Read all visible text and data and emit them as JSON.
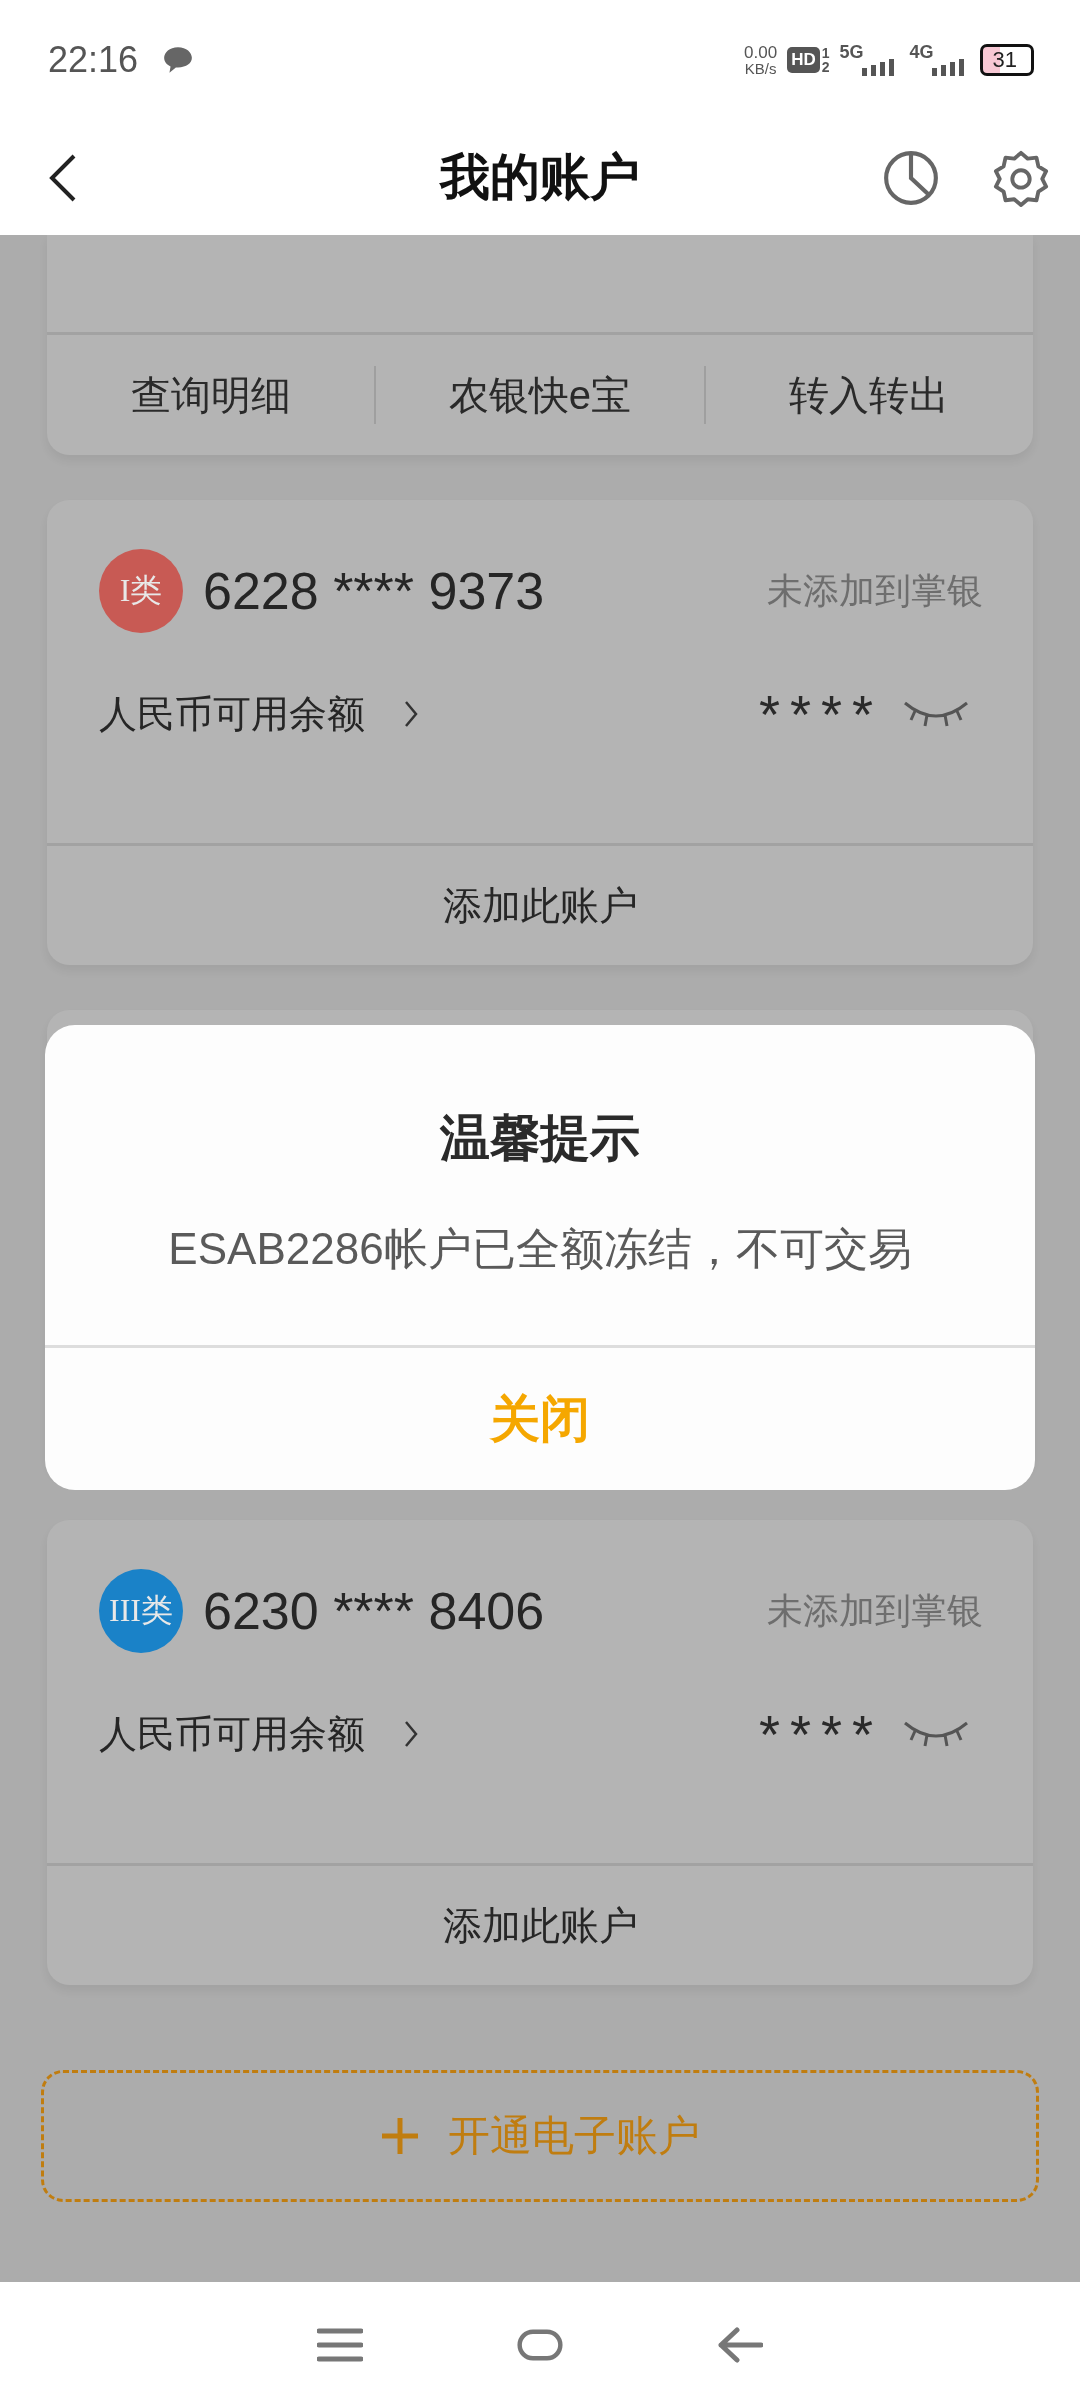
{
  "status_bar": {
    "time": "22:16",
    "net_speed": "0.00",
    "net_unit": "KB/s",
    "hd": "HD",
    "sim_1": "1",
    "sim_2": "2",
    "net_5g": "5G",
    "net_4g": "4G",
    "battery": "31"
  },
  "header": {
    "title": "我的账户"
  },
  "top_card": {
    "actions": [
      "查询明细",
      "农银快e宝",
      "转入转出"
    ]
  },
  "accounts": [
    {
      "kind": "account",
      "badge": "I类",
      "color": "#c85a54",
      "number": "6228 **** 9373",
      "status": "未添加到掌银",
      "balance_label": "人民币可用余额",
      "balance": "****",
      "add_label": "添加此账户"
    },
    {
      "kind": "covered"
    },
    {
      "kind": "account",
      "badge": "III类",
      "color": "#1a82c8",
      "number": "6230 **** 8406",
      "status": "未添加到掌银",
      "balance_label": "人民币可用余额",
      "balance": "****",
      "add_label": "添加此账户"
    }
  ],
  "open_button": {
    "label": "开通电子账户"
  },
  "dialog": {
    "title": "温馨提示",
    "message": "ESAB2286帐户已全额冻结，不可交易",
    "button": "关闭"
  }
}
